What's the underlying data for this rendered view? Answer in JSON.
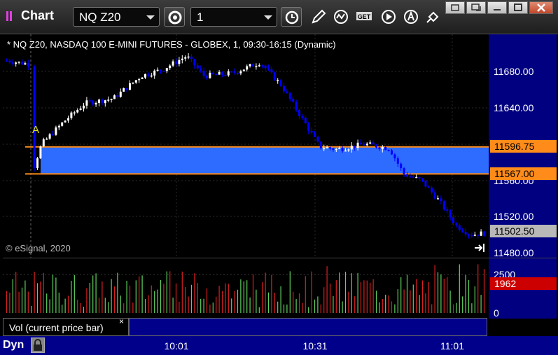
{
  "window": {
    "title": "Chart",
    "symbol": "NQ Z20",
    "interval": "1",
    "toolbar_icons": [
      "symbol-settings-icon",
      "clock-icon",
      "pencil-icon",
      "study-icon",
      "get-icon",
      "play-icon",
      "alert-icon",
      "link-icon"
    ],
    "window_controls": [
      "restore-icon",
      "cascade-icon",
      "maximize-icon",
      "close-icon"
    ]
  },
  "chart": {
    "header": "* NQ Z20, NASDAQ 100 E-MINI FUTURES - GLOBEX, 1, 09:30-16:15 (Dynamic)",
    "copyright": "© eSignal, 2020",
    "marker": "A",
    "price_labels": [
      "11680.00",
      "11640.00",
      "11560.00",
      "11520.00",
      "11480.00"
    ],
    "tags": {
      "upper_band": "11596.75",
      "lower_band": "11567.00",
      "last_price": "11502.50"
    },
    "colors": {
      "up": "#ffffff",
      "down": "#0000ff",
      "band": "#2e6bff",
      "band_line": "#ff8c1a",
      "scale_bg": "#000080"
    }
  },
  "volume": {
    "scale_top": "2500",
    "scale_bottom": "0",
    "current": "1962",
    "study_label": "Vol (current price bar)",
    "close": "×",
    "colors": {
      "up": "#5fd35f",
      "down": "#d92020",
      "current_tag": "#cc0000"
    }
  },
  "time_axis": {
    "labels": [
      "10:01",
      "10:31",
      "11:01"
    ],
    "dyn_label": "Dyn"
  },
  "chart_data": {
    "type": "candlestick",
    "y_axis_ticks": [
      11480,
      11520,
      11560,
      11640,
      11680
    ],
    "band": {
      "upper": 11596.75,
      "lower": 11567.0
    },
    "last": 11502.5,
    "volume_current": 1962,
    "volume_axis": [
      0,
      2500
    ]
  }
}
